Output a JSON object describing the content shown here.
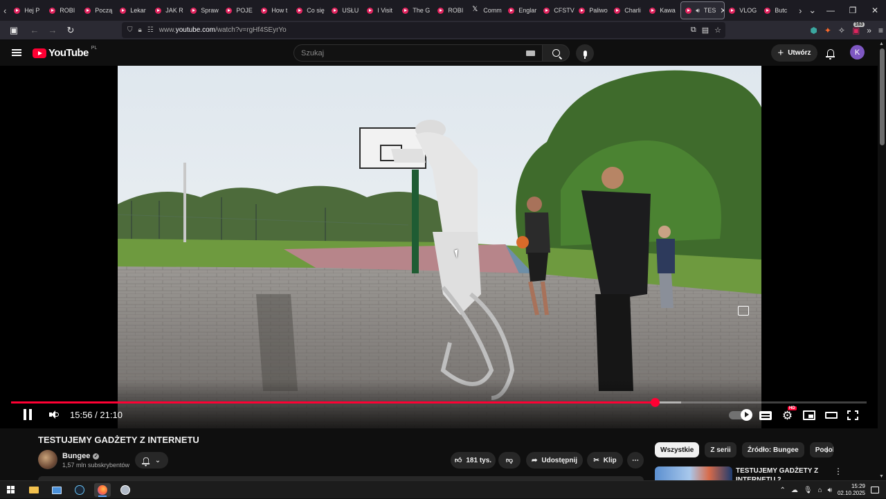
{
  "browser": {
    "tabs": [
      {
        "label": "Hej P",
        "icon": "youtube-icon"
      },
      {
        "label": "ROBI",
        "icon": "youtube-icon"
      },
      {
        "label": "Począ",
        "icon": "youtube-icon"
      },
      {
        "label": "Lekar",
        "icon": "youtube-icon"
      },
      {
        "label": "JAK R",
        "icon": "youtube-icon"
      },
      {
        "label": "Spraw",
        "icon": "youtube-icon"
      },
      {
        "label": "POJE",
        "icon": "youtube-icon"
      },
      {
        "label": "How t",
        "icon": "youtube-icon"
      },
      {
        "label": "Co się",
        "icon": "youtube-icon"
      },
      {
        "label": "USŁU",
        "icon": "youtube-icon"
      },
      {
        "label": "I Visit",
        "icon": "youtube-icon"
      },
      {
        "label": "The G",
        "icon": "youtube-icon"
      },
      {
        "label": "ROBI",
        "icon": "youtube-icon"
      },
      {
        "label": "Comm",
        "icon": "x-icon"
      },
      {
        "label": "Englar",
        "icon": "youtube-icon"
      },
      {
        "label": "CFSTV",
        "icon": "youtube-icon"
      },
      {
        "label": "Paliwo",
        "icon": "youtube-icon"
      },
      {
        "label": "Charli",
        "icon": "youtube-icon"
      },
      {
        "label": "Kawa",
        "icon": "youtube-icon"
      },
      {
        "label": "TES",
        "icon": "youtube-icon",
        "active": true
      },
      {
        "label": "VLOG",
        "icon": "youtube-icon"
      },
      {
        "label": "Butc",
        "icon": "youtube-icon"
      }
    ],
    "url_prefix": "www.",
    "url_host": "youtube.com",
    "url_path": "/watch?v=rgHf4SEyrYo",
    "extension_badge": "163"
  },
  "header": {
    "logo_word": "YouTube",
    "logo_country": "PL",
    "search_placeholder": "Szukaj",
    "create_label": "Utwórz",
    "avatar_letter": "K"
  },
  "player": {
    "time_current": "15:56",
    "time_total": "21:10",
    "time_separator": " / ",
    "progress_fraction": 0.7528,
    "buffer_fraction": 0.783,
    "hd_label": "HD"
  },
  "video": {
    "title": "TESTUJEMY GADŻETY Z INTERNETU",
    "channel_name": "Bungee",
    "subscribers": "1,57 mln subskrybentów",
    "likes": "181 tys.",
    "share_label": "Udostępnij",
    "clip_label": "Klip"
  },
  "sidebar": {
    "chips": [
      {
        "label": "Wszystkie",
        "active": true
      },
      {
        "label": "Z serii",
        "active": false
      },
      {
        "label": "Źródło: Bungee",
        "active": false
      },
      {
        "label": "Podobne",
        "active": false
      }
    ],
    "rec_title": "TESTUJEMY GADŻETY Z INTERNETU 2"
  },
  "taskbar": {
    "time": "15:29",
    "date": "02.10.2025"
  },
  "colors": {
    "accent": "#ff0033",
    "background": "#0f0f0f",
    "avatar": "#7e57c2"
  }
}
